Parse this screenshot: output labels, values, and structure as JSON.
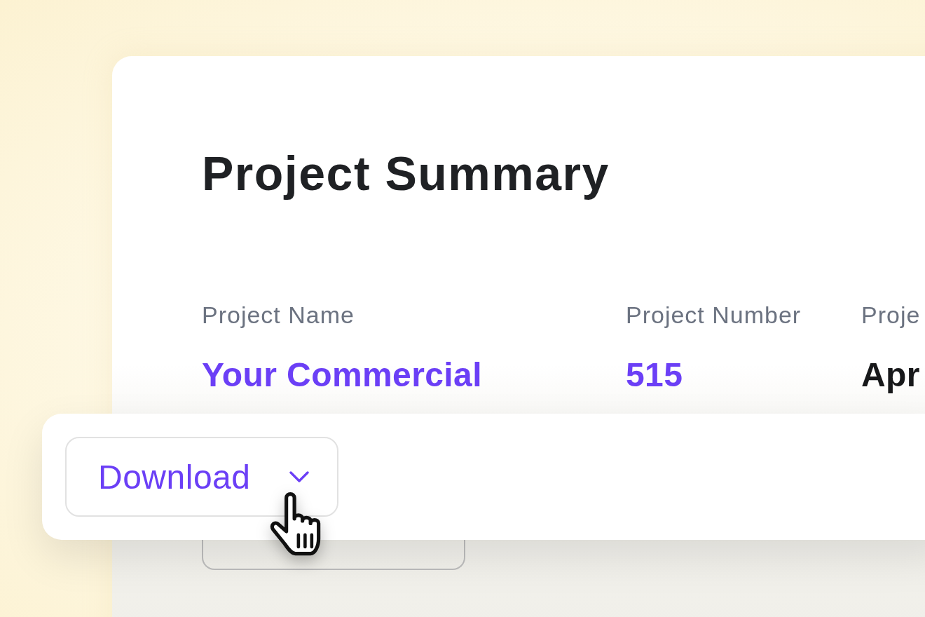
{
  "title": "Project Summary",
  "fields": [
    {
      "label": "Project Name",
      "value": "Your Commercial",
      "kind": "accent"
    },
    {
      "label": "Project Number",
      "value": "515",
      "kind": "accent"
    },
    {
      "label": "Proje",
      "value": "Apr",
      "kind": "plain"
    }
  ],
  "download_button": {
    "label": "Download"
  }
}
